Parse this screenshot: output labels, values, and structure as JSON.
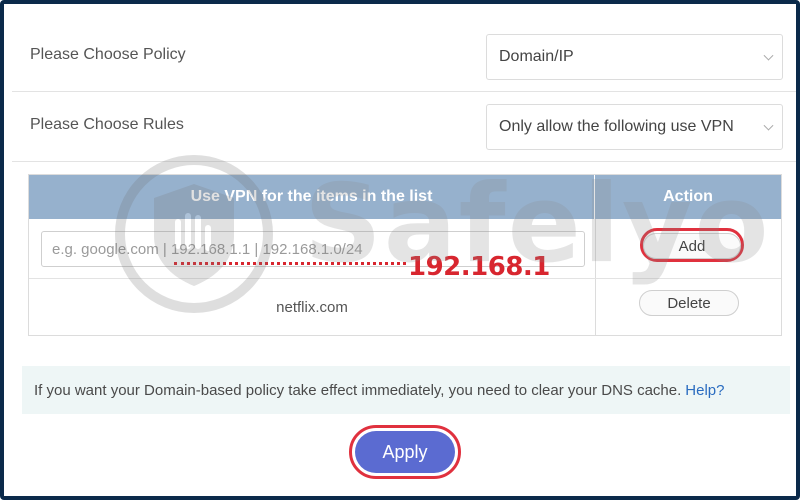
{
  "policy": {
    "label": "Please Choose Policy",
    "selected": "Domain/IP"
  },
  "rules": {
    "label": "Please Choose Rules",
    "selected": "Only allow the following use VPN"
  },
  "table": {
    "columns": [
      "Use VPN for the items in the list",
      "Action"
    ],
    "input_placeholder": "e.g. google.com | 192.168.1.1 | 192.168.1.0/24",
    "add_label": "Add",
    "rows": [
      {
        "item": "netflix.com",
        "action_label": "Delete"
      }
    ]
  },
  "annotation": {
    "ip_text": "192.168.1",
    "highlight_color": "#e0313e"
  },
  "notice": {
    "text": "If you want your Domain-based policy take effect immediately, you need to clear your DNS cache.",
    "help_link": "Help?"
  },
  "apply_label": "Apply",
  "watermark": {
    "brand": "Safelyo",
    "icon": "shield-hand-logo"
  },
  "colors": {
    "header_bg": "#96b1cd",
    "apply_bg": "#5b6bd1",
    "notice_bg": "#eef6f6",
    "frame": "#0b2a4a",
    "link": "#2a6cc0"
  }
}
